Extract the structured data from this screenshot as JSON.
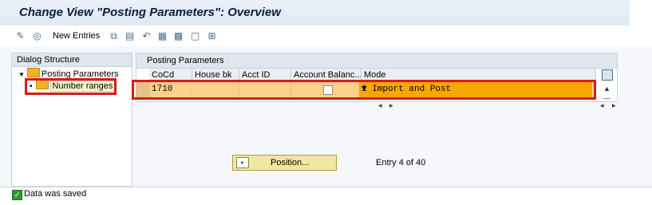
{
  "window": {
    "title": "Change View \"Posting Parameters\": Overview"
  },
  "toolbar": {
    "new_entries_label": "New Entries",
    "icons": [
      "display-change-icon",
      "glasses-icon",
      "copy-icon",
      "delete-icon",
      "undo-icon",
      "select-all-icon",
      "select-block-icon",
      "deselect-all-icon",
      "details-icon"
    ]
  },
  "dialog_structure": {
    "header": "Dialog Structure",
    "items": [
      {
        "label": "Posting Parameters"
      },
      {
        "label": "Number ranges"
      }
    ]
  },
  "table": {
    "title": "Posting Parameters",
    "columns": [
      "CoCd",
      "House bk",
      "Acct ID",
      "Account Balanc...",
      "Mode"
    ],
    "rows": [
      {
        "CoCd": "1710",
        "House bk": "",
        "Acct ID": "",
        "Account Balance": false,
        "Mode": "1 Import and Post"
      }
    ]
  },
  "footer": {
    "position_button_label": "Position...",
    "entry_info": "Entry 4 of 40"
  },
  "status": {
    "message": "Data was saved"
  },
  "colors": {
    "highlight_row": "#f8d28d",
    "dropdown_active": "#f7a800",
    "red_annotation": "#d81b1b",
    "status_ok": "#2f9b2f"
  }
}
